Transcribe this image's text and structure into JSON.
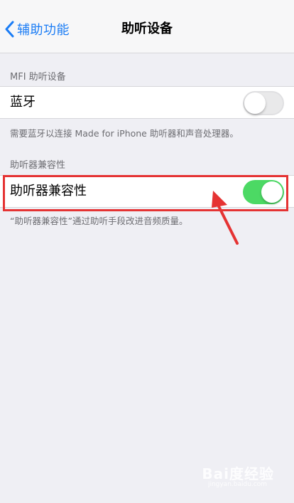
{
  "nav": {
    "back_label": "辅助功能",
    "title": "助听设备"
  },
  "mfi_section": {
    "header": "MFI 助听设备",
    "bluetooth_label": "蓝牙",
    "bluetooth_on": false,
    "footer": "需要蓝牙以连接 Made for iPhone 助听器和声音处理器。"
  },
  "compat_section": {
    "header": "助听器兼容性",
    "toggle_label": "助听器兼容性",
    "toggle_on": true,
    "footer": "“助听器兼容性”通过助听手段改进音频质量。"
  },
  "colors": {
    "accent_blue": "#1a7cf5",
    "switch_on": "#4cd964",
    "annotation_red": "#e53333"
  },
  "watermark": {
    "text": "Bai度经验",
    "sub": "jingyan.baidu.com"
  }
}
